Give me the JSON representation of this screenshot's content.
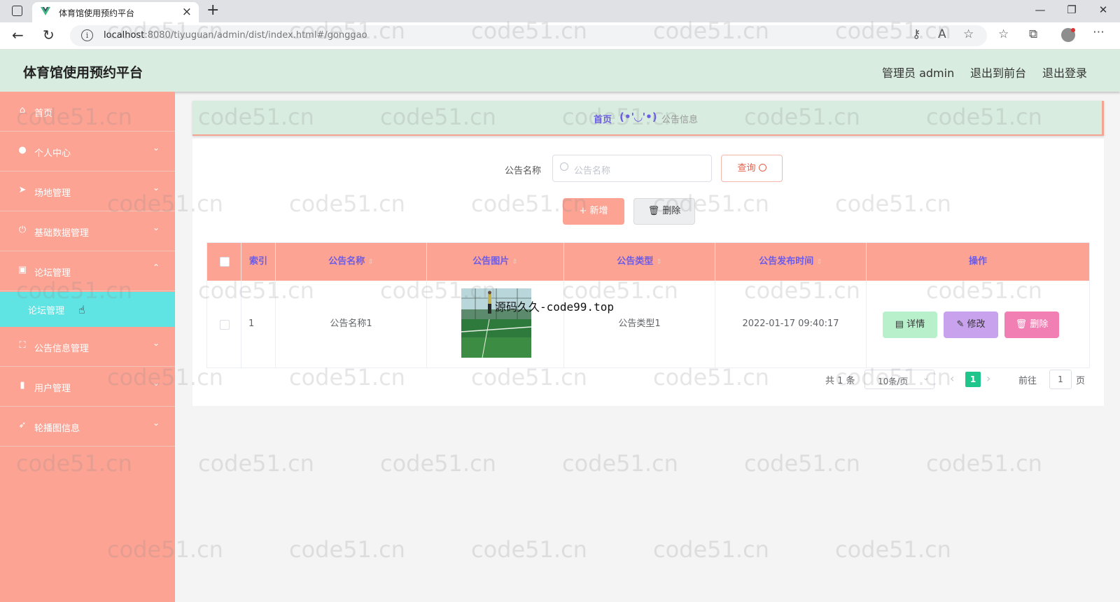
{
  "browser": {
    "tab_title": "体育馆使用预约平台",
    "url_main": "localhost",
    "url_rest": ":8080/tiyuguan/admin/dist/index.html#/gonggao"
  },
  "header": {
    "title": "体育馆使用预约平台",
    "user_label": "管理员 admin",
    "front_link": "退出到前台",
    "logout_link": "退出登录"
  },
  "sidebar": {
    "items": [
      {
        "label": "首页",
        "icon": "home-icon"
      },
      {
        "label": "个人中心",
        "icon": "user-icon"
      },
      {
        "label": "场地管理",
        "icon": "send-icon"
      },
      {
        "label": "基础数据管理",
        "icon": "power-icon"
      },
      {
        "label": "论坛管理",
        "icon": "forum-icon"
      },
      {
        "label": "公告信息管理",
        "icon": "frame-icon"
      },
      {
        "label": "用户管理",
        "icon": "bar-chart-icon"
      },
      {
        "label": "轮播图信息",
        "icon": "navigation-icon"
      }
    ],
    "submenu_label": "论坛管理"
  },
  "breadcrumb": {
    "home": "首页",
    "separator": "(•'◡'•)",
    "current": "公告信息"
  },
  "search": {
    "label": "公告名称",
    "placeholder": "公告名称",
    "button": "查询"
  },
  "actions": {
    "add": "新增",
    "delete": "删除"
  },
  "table": {
    "columns": [
      "索引",
      "公告名称",
      "公告图片",
      "公告类型",
      "公告发布时间",
      "操作"
    ],
    "rows": [
      {
        "index": "1",
        "name": "公告名称1",
        "type": "公告类型1",
        "time": "2022-01-17 09:40:17"
      }
    ],
    "image_watermark": "源码久久-code99.top",
    "row_actions": {
      "detail": "详情",
      "edit": "修改",
      "delete": "删除"
    }
  },
  "pagination": {
    "total": "共 1 条",
    "page_size": "10条/页",
    "current_page": "1",
    "goto_label": "前往",
    "goto_value": "1",
    "page_suffix": "页"
  },
  "watermark_text": "code51.cn",
  "colors": {
    "sidebar": "#fca393",
    "header": "#d8ecdf",
    "active_submenu": "#5fe3e3",
    "table_header": "#fca393",
    "detail_btn": "#b8f0cc",
    "edit_btn": "#c9a2ee",
    "delete_btn": "#f27fb4",
    "pagination_active": "#20c58b"
  }
}
